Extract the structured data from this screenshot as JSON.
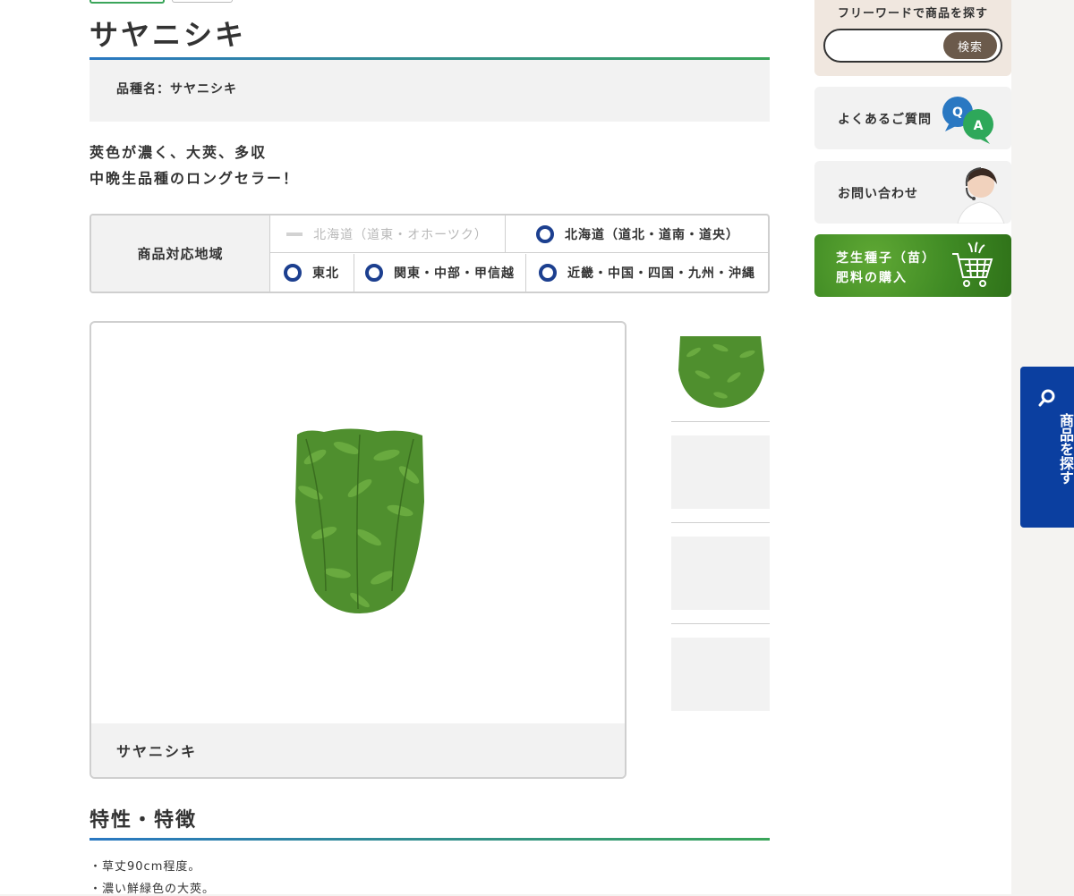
{
  "product": {
    "title": "サヤニシキ",
    "name_label": "品種名：サヤニシキ",
    "tagline": [
      "莢色が濃く、大莢、多収",
      "中晩生品種のロングセラー！"
    ]
  },
  "region": {
    "heading": "商品対応地域",
    "areas": [
      {
        "label": "北海道（道東・オホーツク）",
        "active": false
      },
      {
        "label": "北海道（道北・道南・道央）",
        "active": true
      },
      {
        "label": "東北",
        "active": true
      },
      {
        "label": "関東・中部・甲信越",
        "active": true
      },
      {
        "label": "近畿・中国・四国・九州・沖縄",
        "active": true
      }
    ]
  },
  "gallery": {
    "main_caption": "サヤニシキ"
  },
  "features": {
    "heading": "特性・特徴",
    "items": [
      "・草丈90cm程度。",
      "・濃い鮮緑色の大莢。"
    ]
  },
  "sidebar": {
    "search_label": "フリーワードで商品を探す",
    "search_placeholder": "",
    "search_button": "検索",
    "faq_label": "よくあるご質問",
    "contact_label": "お問い合わせ",
    "shop_line1": "芝生種子（苗）",
    "shop_line2": "肥料の購入",
    "float_label": "商品を探す"
  },
  "colors": {
    "accent_blue": "#0b3fa0",
    "radio_blue": "#1c3f8f",
    "rule_start": "#2a78c2",
    "rule_end": "#3aa55a"
  }
}
